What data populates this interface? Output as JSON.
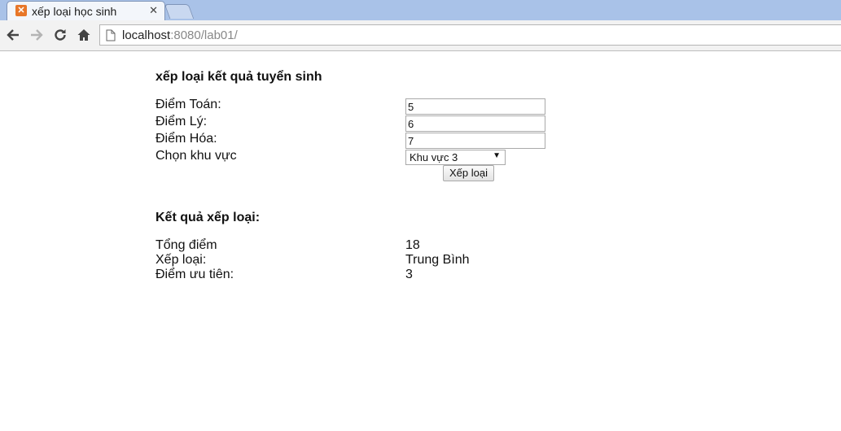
{
  "browser": {
    "tab_title": "xếp loại học sinh",
    "url_host": "localhost",
    "url_rest": ":8080/lab01/"
  },
  "form": {
    "heading": "xếp loại kết quả tuyển sinh",
    "toan_label": "Điểm Toán:",
    "toan_value": "5",
    "ly_label": "Điểm Lý:",
    "ly_value": "6",
    "hoa_label": "Điểm Hóa:",
    "hoa_value": "7",
    "khuvuc_label": "Chọn khu vực",
    "khuvuc_selected": "Khu vực 3",
    "submit_label": "Xếp loại"
  },
  "result": {
    "heading": "Kết quả xếp loại:",
    "tong_label": "Tổng điểm",
    "tong_value": "18",
    "xeploai_label": "Xếp loại:",
    "xeploai_value": "Trung Bình",
    "uutien_label": "Điểm ưu tiên:",
    "uutien_value": "3"
  }
}
